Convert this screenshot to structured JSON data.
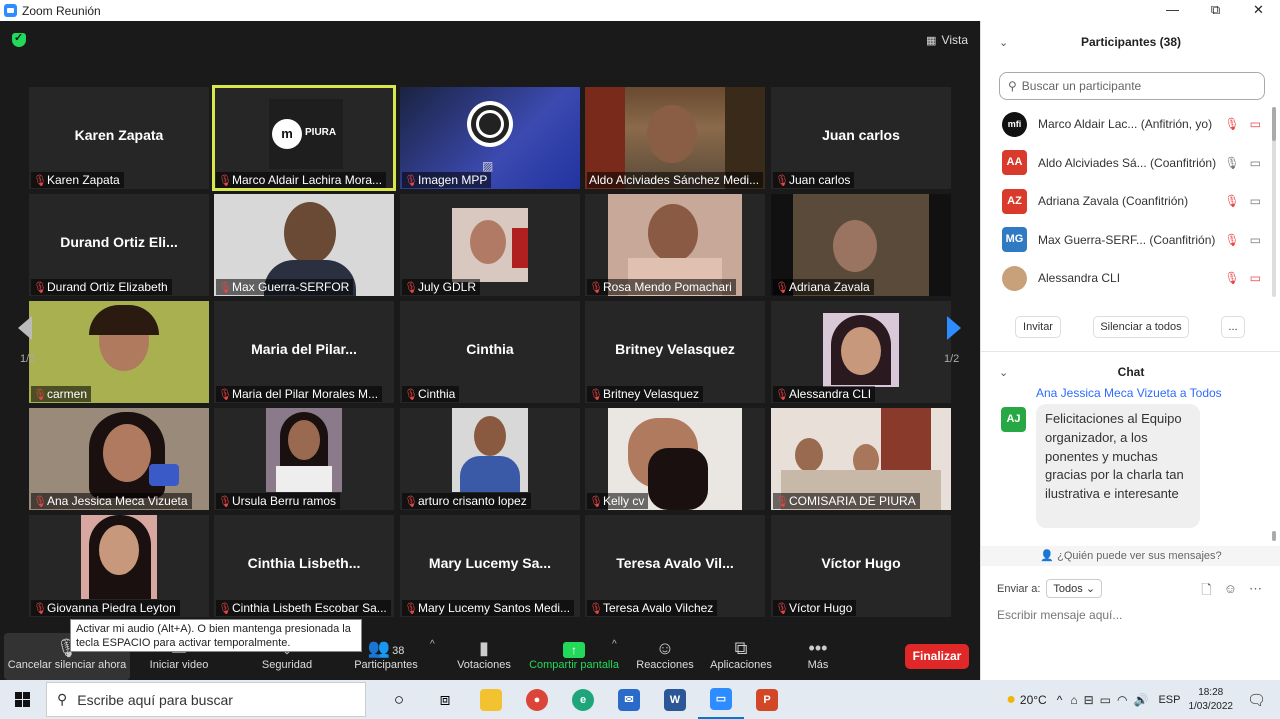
{
  "window": {
    "title": "Zoom Reunión",
    "minimize": "—",
    "maximize": "⧉",
    "close": "✕"
  },
  "meeting": {
    "view_label": "Vista",
    "page_left": "1/2",
    "page_right": "1/2",
    "tiles": [
      {
        "label": "Karen Zapata",
        "bigname": "Karen Zapata"
      },
      {
        "label": "Marco Aldair Lachira Mora...",
        "bigname": "",
        "logo": "PIURA"
      },
      {
        "label": "Imagen MPP",
        "bigname": ""
      },
      {
        "label": "Aldo Alciviades Sánchez Medi...",
        "bigname": ""
      },
      {
        "label": "Juan carlos",
        "bigname": "Juan carlos"
      },
      {
        "label": "Durand Ortiz Elizabeth",
        "bigname": "Durand  Ortiz  Eli..."
      },
      {
        "label": "Max Guerra-SERFOR",
        "bigname": ""
      },
      {
        "label": "July GDLR",
        "bigname": ""
      },
      {
        "label": "Rosa Mendo Pomachari",
        "bigname": ""
      },
      {
        "label": "Adriana Zavala",
        "bigname": ""
      },
      {
        "label": "carmen",
        "bigname": ""
      },
      {
        "label": "Maria del Pilar Morales M...",
        "bigname": "Maria  del  Pilar..."
      },
      {
        "label": "Cinthia",
        "bigname": "Cinthia"
      },
      {
        "label": "Britney Velasquez",
        "bigname": "Britney Velasquez"
      },
      {
        "label": "Alessandra CLI",
        "bigname": ""
      },
      {
        "label": "Ana Jessica Meca Vizueta",
        "bigname": ""
      },
      {
        "label": "Ursula Berru ramos",
        "bigname": ""
      },
      {
        "label": "arturo crisanto lopez",
        "bigname": ""
      },
      {
        "label": "Kelly cv",
        "bigname": ""
      },
      {
        "label": "COMISARIA DE PIURA",
        "bigname": ""
      },
      {
        "label": "Giovanna Piedra Leyton",
        "bigname": ""
      },
      {
        "label": "Cinthia Lisbeth Escobar Sa...",
        "bigname": "Cinthia  Lisbeth..."
      },
      {
        "label": "Mary Lucemy Santos Medi...",
        "bigname": "Mary  Lucemy  Sa..."
      },
      {
        "label": "Teresa Avalo Vilchez",
        "bigname": "Teresa  Avalo  Vil..."
      },
      {
        "label": "Víctor Hugo",
        "bigname": "Víctor Hugo"
      }
    ]
  },
  "tooltip": {
    "text": "Activar mi audio (Alt+A). O bien mantenga presionada la tecla ESPACIO para activar temporalmente."
  },
  "toolbar": {
    "mute": "Cancelar silenciar ahora",
    "video": "Iniciar video",
    "security": "Seguridad",
    "participants": "Participantes",
    "participants_count": "38",
    "polls": "Votaciones",
    "share": "Compartir pantalla",
    "reactions": "Reacciones",
    "apps": "Aplicaciones",
    "more": "Más",
    "end": "Finalizar"
  },
  "panel": {
    "participants_title": "Participantes (38)",
    "search_placeholder": "Buscar un participante",
    "participants": [
      {
        "initials": "",
        "name": "Marco Aldair Lac...  (Anfitrión, yo)",
        "color": "#111111"
      },
      {
        "initials": "AA",
        "name": "Aldo Alciviades Sá...  (Coanfitrión)",
        "color": "#d93a2b"
      },
      {
        "initials": "AZ",
        "name": "Adriana Zavala (Coanfitrión)",
        "color": "#d93a2b"
      },
      {
        "initials": "MG",
        "name": "Max Guerra-SERF...  (Coanfitrión)",
        "color": "#2f7ac2"
      },
      {
        "initials": "",
        "name": "Alessandra CLI",
        "color": "#c8a07a"
      }
    ],
    "invite": "Invitar",
    "mute_all": "Silenciar a todos",
    "more": "...",
    "chat_title": "Chat",
    "chat_sender": "Ana Jessica Meca Vizueta a Todos",
    "chat_initials": "AJ",
    "chat_message": "Felicitaciones al Equipo organizador, a los ponentes  y muchas gracias por la charla tan ilustrativa e interesante",
    "who_can_see": "¿Quién puede ver sus mensajes?",
    "send_to_label": "Enviar a:",
    "send_to_value": "Todos",
    "message_placeholder": "Escribir mensaje aquí..."
  },
  "taskbar": {
    "search": "Escribe aquí para buscar",
    "temperature": "20°C",
    "language": "ESP",
    "time": "18:28",
    "date": "1/03/2022"
  }
}
